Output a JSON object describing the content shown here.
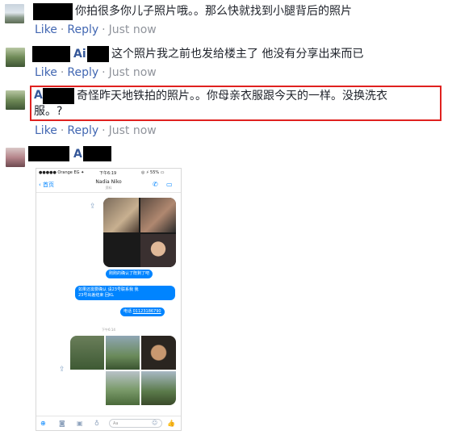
{
  "comments": [
    {
      "text": "你拍很多你儿子照片哦。。那么快就找到小腿背后的照片",
      "actions": {
        "like": "Like",
        "reply": "Reply",
        "time": "Just now"
      }
    },
    {
      "name_prefix": "Ai",
      "text": "这个照片我之前也发给楼主了 他没有分享出来而已",
      "actions": {
        "like": "Like",
        "reply": "Reply",
        "time": "Just now"
      }
    },
    {
      "name_prefix": "A",
      "text_line1": "奇怪昨天地铁拍的照片。。你母亲衣服跟今天的一样。没换洗衣",
      "text_line2": "服。?",
      "actions": {
        "like": "Like",
        "reply": "Reply",
        "time": "Just now"
      }
    },
    {
      "name_prefix": "Ai"
    }
  ],
  "phone": {
    "status_carrier": "●●●●● Orange EG ✦",
    "status_time": "下午6:19",
    "status_battery": "◎ ⚡ 55% ▭",
    "back_label": "首页",
    "contact_name": "Nadia Niko",
    "contact_sub": "资料",
    "msg1": "刚刚的确认了既剩了吧",
    "msg2_line1": "如果还需要确认 请23号联系我 我",
    "msg2_line2": "23号出差结束 回KL",
    "msg3_prefix": "电话",
    "msg3_number": "01123186790",
    "timestamp": "下午6:14",
    "input_placeholder": "Aa"
  },
  "colors": {
    "link": "#4267b2",
    "highlight": "#e0211f",
    "messenger_blue": "#0084ff"
  }
}
